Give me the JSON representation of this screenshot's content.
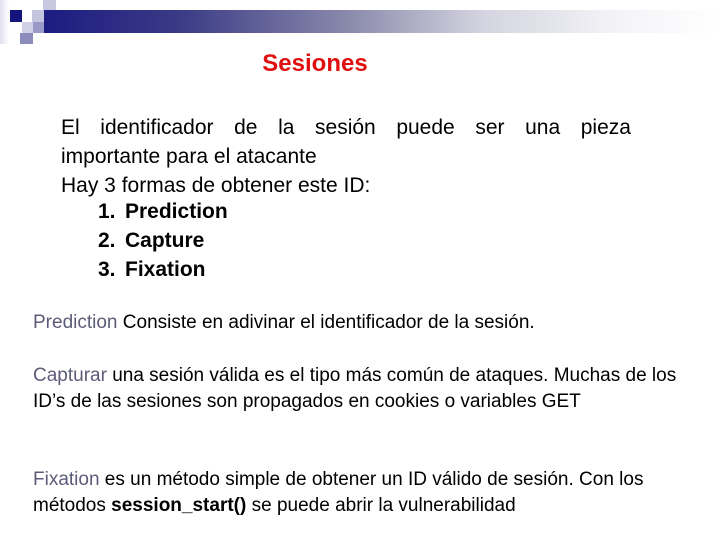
{
  "slide": {
    "title": "Sesiones",
    "intro": {
      "line1_words": [
        "El",
        "identificador",
        "de",
        "la",
        "sesión",
        "puede",
        "ser",
        "una",
        "pieza"
      ],
      "line2": "importante para el atacante",
      "line3": "Hay 3 formas de obtener este ID:"
    },
    "methods": [
      {
        "num": "1.",
        "label": "Prediction"
      },
      {
        "num": "2.",
        "label": "Capture"
      },
      {
        "num": "3.",
        "label": "Fixation"
      }
    ],
    "paragraphs": {
      "prediction": {
        "keyword": "Prediction",
        "text": " Consiste en adivinar el identificador de la sesión."
      },
      "capture": {
        "keyword": "Capturar",
        "text": " una sesión válida es el tipo más común de ataques. Muchas de los ID’s de las sesiones son propagados en cookies o variables GET"
      },
      "fixation": {
        "keyword": "Fixation",
        "text": " es un método simple de obtener un ID válido de sesión. Con los métodos ",
        "code": "session_start()",
        "text_after": " se puede abrir la vulnerabilidad"
      }
    },
    "colors": {
      "title": "#e01010",
      "keyword": "#5c5c78",
      "header_bar_start": "#1c1c82"
    }
  }
}
